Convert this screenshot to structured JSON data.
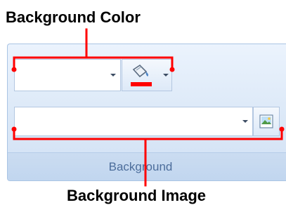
{
  "callouts": {
    "top": "Background Color",
    "bottom": "Background Image"
  },
  "ribbon": {
    "group_label": "Background",
    "color_combo_value": "",
    "image_combo_value": ""
  },
  "icons": {
    "fill": "paint-bucket-icon",
    "picture": "picture-icon",
    "dropdown": "chevron-down-icon"
  },
  "colors": {
    "callout_line": "#ff0000",
    "fill_swatch": "#ff0000",
    "group_label_text": "#4c6d9b",
    "ribbon_border": "#a9c4e4"
  }
}
